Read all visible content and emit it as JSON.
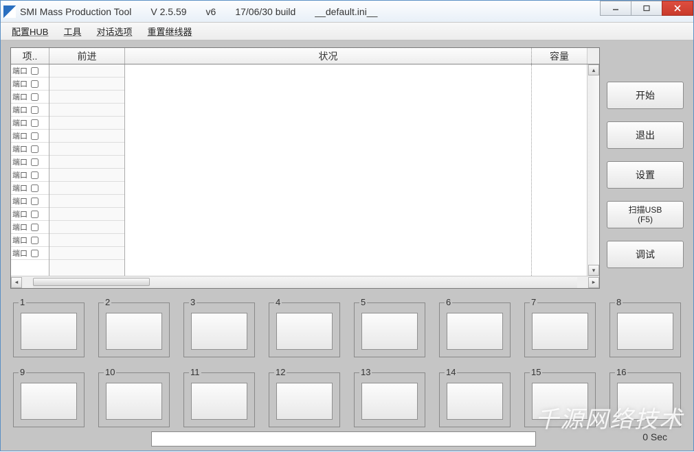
{
  "title": {
    "app_name": "SMI Mass Production Tool",
    "version": "V 2.5.59",
    "sub_version": "v6",
    "build": "17/06/30 build",
    "config_file": "__default.ini__"
  },
  "menu": {
    "items": [
      "配置HUB",
      "工具",
      "对话选项",
      "重置继线器"
    ]
  },
  "grid": {
    "headers": {
      "item": "项..",
      "pretest": "前进",
      "status": "状况",
      "capacity": "容量"
    },
    "rows": [
      {
        "port": "端口",
        "checked": false
      },
      {
        "port": "端口",
        "checked": false
      },
      {
        "port": "端口",
        "checked": false
      },
      {
        "port": "端口",
        "checked": false
      },
      {
        "port": "端口",
        "checked": false
      },
      {
        "port": "端口",
        "checked": false
      },
      {
        "port": "端口",
        "checked": false
      },
      {
        "port": "端口",
        "checked": false
      },
      {
        "port": "端口",
        "checked": false
      },
      {
        "port": "端口",
        "checked": false
      },
      {
        "port": "端口",
        "checked": false
      },
      {
        "port": "端口",
        "checked": false
      },
      {
        "port": "端口",
        "checked": false
      },
      {
        "port": "端口",
        "checked": false
      },
      {
        "port": "端口",
        "checked": false
      }
    ]
  },
  "buttons": {
    "start": "开始",
    "quit": "退出",
    "setting": "设置",
    "scan_line1": "扫描USB",
    "scan_line2": "(F5)",
    "debug": "调试"
  },
  "slots": [
    "1",
    "2",
    "3",
    "4",
    "5",
    "6",
    "7",
    "8",
    "9",
    "10",
    "11",
    "12",
    "13",
    "14",
    "15",
    "16"
  ],
  "status": {
    "elapsed": "0 Sec"
  },
  "watermark": "千源网络技术"
}
